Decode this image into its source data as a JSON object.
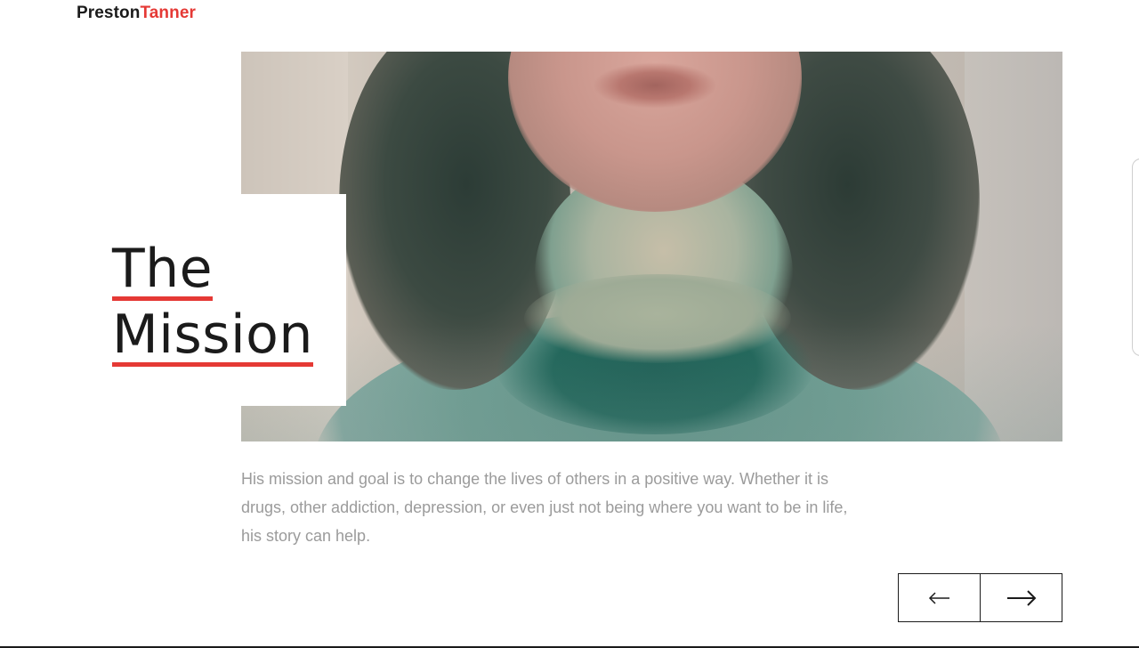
{
  "brand": {
    "first_name": "Preston",
    "last_name": "Tanner"
  },
  "colors": {
    "accent": "#e53935",
    "text": "#1b1b1b",
    "muted": "#9b9b9b"
  },
  "section": {
    "title_line1": "The",
    "title_line2": "Mission",
    "description": "His mission and goal is to change the lives of others in a positive way. Whether it is drugs, other addiction, depression, or even just not being where you want to be in life, his story can help."
  },
  "controls": {
    "prev_icon": "arrow-left-icon",
    "next_icon": "arrow-right-icon"
  }
}
